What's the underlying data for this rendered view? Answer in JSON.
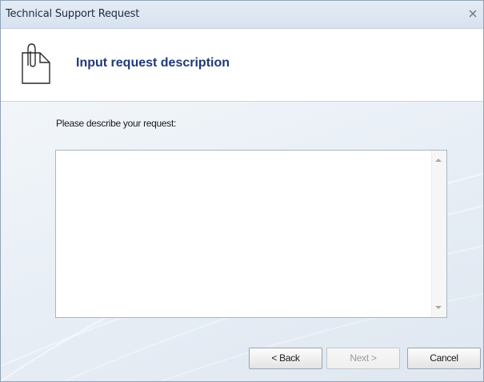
{
  "window": {
    "title": "Technical Support Request"
  },
  "header": {
    "title": "Input request description",
    "icon": "document-clip-icon"
  },
  "form": {
    "prompt": "Please describe your request:",
    "request_value": ""
  },
  "buttons": {
    "back_label": "< Back",
    "next_label": "Next >",
    "cancel_label": "Cancel",
    "next_enabled": false
  },
  "colors": {
    "header_title": "#1f3a78",
    "titlebar": "#dce6f1",
    "body_background": "#eef3f8"
  }
}
